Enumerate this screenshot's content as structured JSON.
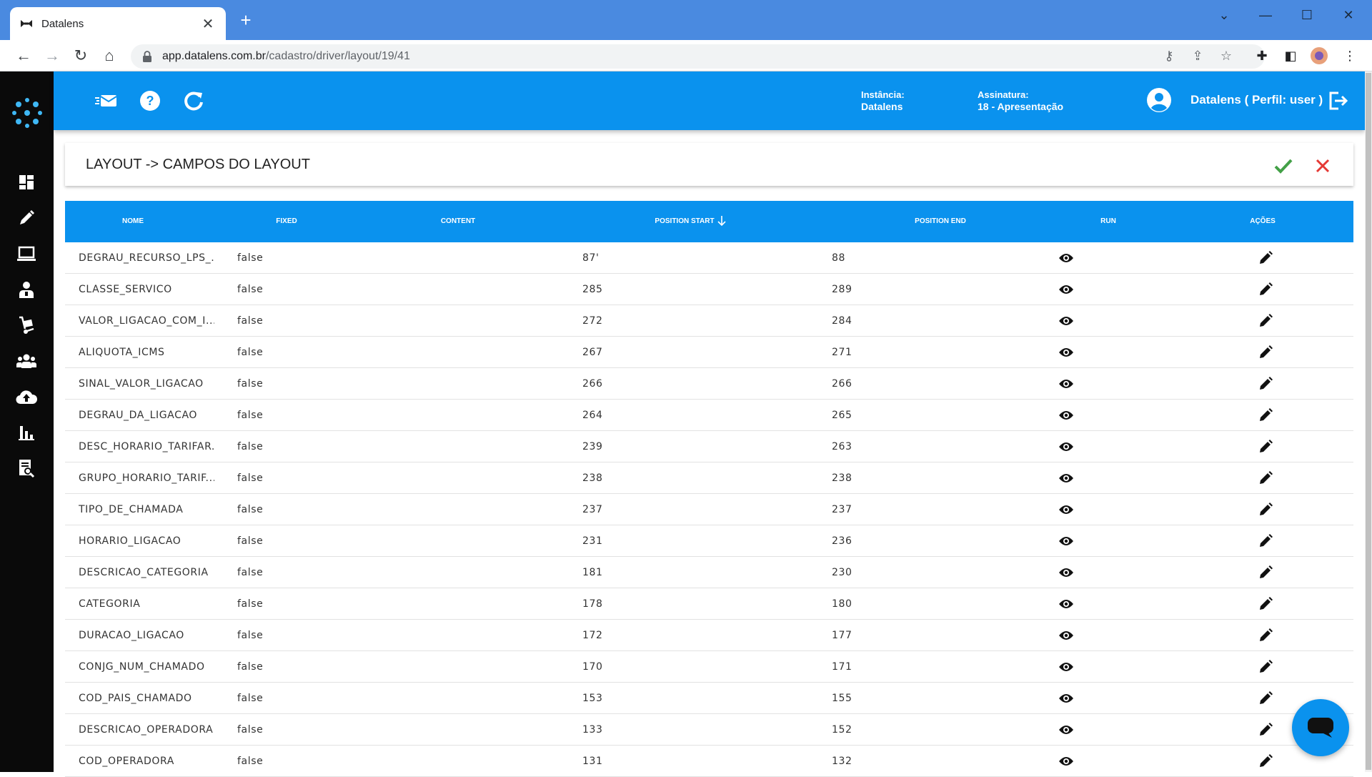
{
  "browser": {
    "tab_title": "Datalens",
    "url_host": "app.datalens.com.br",
    "url_path": "/cadastro/driver/layout/19/41"
  },
  "header": {
    "instancia_label": "Instância:",
    "instancia_value": "Datalens",
    "assinatura_label": "Assinatura:",
    "assinatura_value": "18 - Apresentação",
    "user_label": "Datalens ( Perfil: user )"
  },
  "page": {
    "title": "LAYOUT -> CAMPOS DO LAYOUT"
  },
  "table": {
    "columns": [
      "NOME",
      "FIXED",
      "CONTENT",
      "POSITION START",
      "POSITION END",
      "RUN",
      "AÇÕES"
    ],
    "rows": [
      {
        "nome": "DEGRAU_RECURSO_LPS_...",
        "fixed": "false",
        "start": "87'",
        "end": "88"
      },
      {
        "nome": "CLASSE_SERVICO",
        "fixed": "false",
        "start": "285",
        "end": "289"
      },
      {
        "nome": "VALOR_LIGACAO_COM_I...",
        "fixed": "false",
        "start": "272",
        "end": "284"
      },
      {
        "nome": "ALIQUOTA_ICMS",
        "fixed": "false",
        "start": "267",
        "end": "271"
      },
      {
        "nome": "SINAL_VALOR_LIGACAO",
        "fixed": "false",
        "start": "266",
        "end": "266"
      },
      {
        "nome": "DEGRAU_DA_LIGACAO",
        "fixed": "false",
        "start": "264",
        "end": "265"
      },
      {
        "nome": "DESC_HORARIO_TARIFAR...",
        "fixed": "false",
        "start": "239",
        "end": "263"
      },
      {
        "nome": "GRUPO_HORARIO_TARIF...",
        "fixed": "false",
        "start": "238",
        "end": "238"
      },
      {
        "nome": "TIPO_DE_CHAMADA",
        "fixed": "false",
        "start": "237",
        "end": "237"
      },
      {
        "nome": "HORARIO_LIGACAO",
        "fixed": "false",
        "start": "231",
        "end": "236"
      },
      {
        "nome": "DESCRICAO_CATEGORIA",
        "fixed": "false",
        "start": "181",
        "end": "230"
      },
      {
        "nome": "CATEGORIA",
        "fixed": "false",
        "start": "178",
        "end": "180"
      },
      {
        "nome": "DURACAO_LIGACAO",
        "fixed": "false",
        "start": "172",
        "end": "177"
      },
      {
        "nome": "CONJG_NUM_CHAMADO",
        "fixed": "false",
        "start": "170",
        "end": "171"
      },
      {
        "nome": "COD_PAIS_CHAMADO",
        "fixed": "false",
        "start": "153",
        "end": "155"
      },
      {
        "nome": "DESCRICAO_OPERADORA",
        "fixed": "false",
        "start": "133",
        "end": "152"
      },
      {
        "nome": "COD_OPERADORA",
        "fixed": "false",
        "start": "131",
        "end": "132"
      }
    ]
  },
  "colors": {
    "primary": "#0a92ee",
    "sidebar": "#0a0a0a",
    "confirm": "#43a047",
    "cancel": "#e53935",
    "chrome": "#4a8ae0"
  },
  "icons": {
    "sidebar": [
      "dashboard-icon",
      "edit-icon",
      "laptop-icon",
      "user-tie-icon",
      "dolly-icon",
      "users-icon",
      "cloud-upload-icon",
      "bar-chart-icon",
      "report-search-icon"
    ],
    "header": [
      "mail-icon",
      "help-icon",
      "refresh-icon",
      "account-circle-icon",
      "logout-icon"
    ]
  }
}
